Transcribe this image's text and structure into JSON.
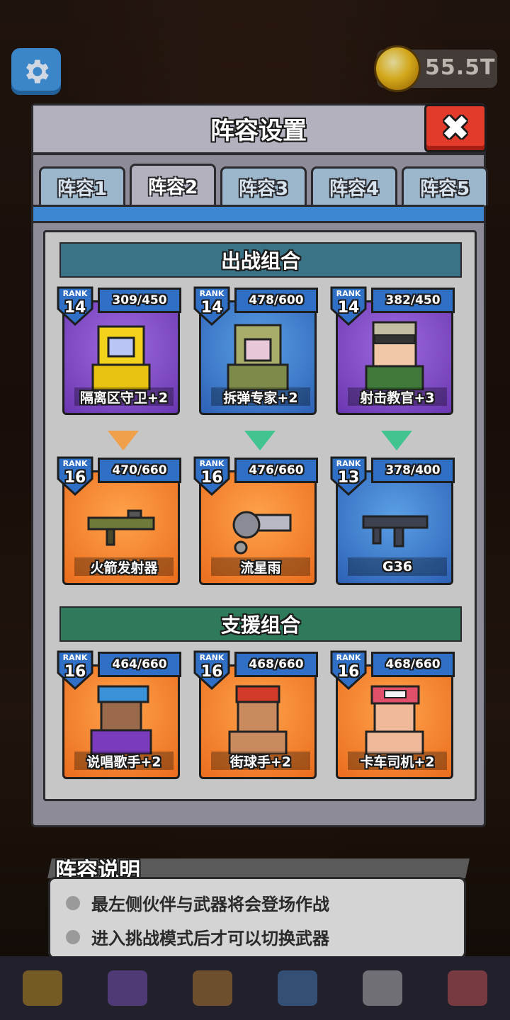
{
  "top": {
    "coins": "55.5T"
  },
  "panel": {
    "title": "阵容设置",
    "close_label": "✖",
    "tabs": [
      "阵容1",
      "阵容2",
      "阵容3",
      "阵容4",
      "阵容5"
    ],
    "active_tab": 1
  },
  "sections": {
    "battle": "出战组合",
    "support": "支援组合"
  },
  "heroes": [
    {
      "rank_label": "RANK",
      "rank": "14",
      "progress": "309/450",
      "name": "隔离区守卫+2",
      "bg": "purple"
    },
    {
      "rank_label": "RANK",
      "rank": "14",
      "progress": "478/600",
      "name": "拆弹专家+2",
      "bg": "blue"
    },
    {
      "rank_label": "RANK",
      "rank": "14",
      "progress": "382/450",
      "name": "射击教官+3",
      "bg": "purple"
    }
  ],
  "weapons": [
    {
      "rank_label": "RANK",
      "rank": "16",
      "progress": "470/660",
      "name": "火箭发射器",
      "bg": "orange"
    },
    {
      "rank_label": "RANK",
      "rank": "16",
      "progress": "476/660",
      "name": "流星雨",
      "bg": "orange"
    },
    {
      "rank_label": "RANK",
      "rank": "13",
      "progress": "378/400",
      "name": "G36",
      "bg": "blue"
    }
  ],
  "supports": [
    {
      "rank_label": "RANK",
      "rank": "16",
      "progress": "464/660",
      "name": "说唱歌手+2",
      "bg": "orange"
    },
    {
      "rank_label": "RANK",
      "rank": "16",
      "progress": "468/660",
      "name": "街球手+2",
      "bg": "orange"
    },
    {
      "rank_label": "RANK",
      "rank": "16",
      "progress": "468/660",
      "name": "卡车司机+2",
      "bg": "orange"
    }
  ],
  "notes": {
    "title": "阵容说明",
    "items": [
      "最左侧伙伴与武器将会登场作战",
      "进入挑战模式后才可以切换武器"
    ]
  },
  "colors": {
    "arrow_orange": "#f0a04a",
    "arrow_green": "#41c490",
    "tab_strip": "#3f86d0"
  }
}
